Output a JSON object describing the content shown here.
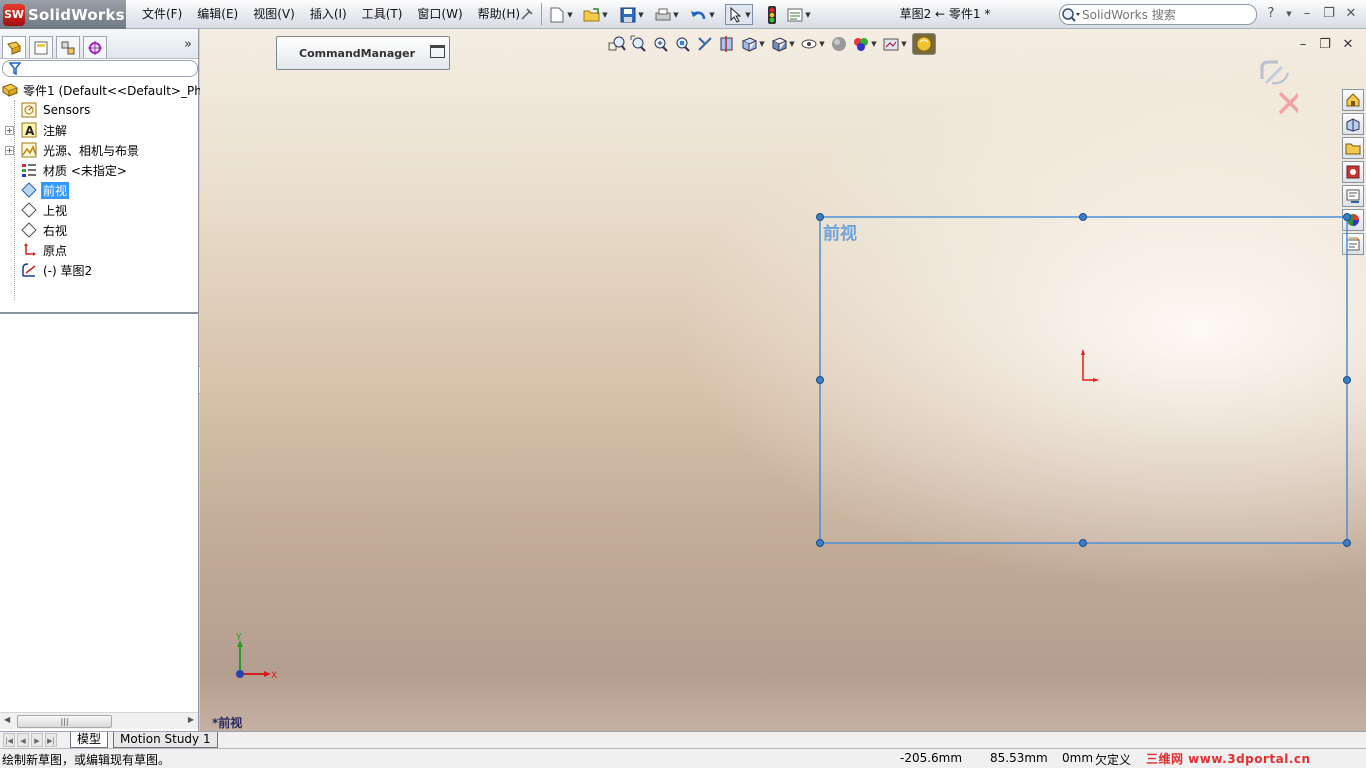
{
  "app": {
    "brand": "SolidWorks",
    "document_title": "草图2 ← 零件1 *",
    "menus": [
      "文件(F)",
      "编辑(E)",
      "视图(V)",
      "插入(I)",
      "工具(T)",
      "窗口(W)",
      "帮助(H)"
    ],
    "search_placeholder": "SolidWorks 搜索",
    "help_label": "?",
    "window_controls": [
      "minimize",
      "restore",
      "close"
    ]
  },
  "feature_manager": {
    "tabs": [
      "featuremanager-tab",
      "propertymanager-tab",
      "configurationmanager-tab",
      "dimxpert-tab"
    ],
    "more": "»",
    "filter_placeholder": "",
    "tree": [
      {
        "label": "零件1  (Default<<Default>_Pho",
        "icon": "part-icon",
        "level": 0,
        "expand": false
      },
      {
        "label": "Sensors",
        "icon": "sensor-icon",
        "level": 1,
        "expand": false
      },
      {
        "label": "注解",
        "icon": "annotation-icon",
        "level": 1,
        "expand": true
      },
      {
        "label": "光源、相机与布景",
        "icon": "lights-cameras-icon",
        "level": 1,
        "expand": true
      },
      {
        "label": "材质 <未指定>",
        "icon": "material-icon",
        "level": 1,
        "expand": false
      },
      {
        "label": "前视",
        "icon": "plane-icon",
        "level": 1,
        "expand": false,
        "selected": true
      },
      {
        "label": "上视",
        "icon": "plane-icon",
        "level": 1,
        "expand": false
      },
      {
        "label": "右视",
        "icon": "plane-icon",
        "level": 1,
        "expand": false
      },
      {
        "label": "原点",
        "icon": "origin-icon",
        "level": 1,
        "expand": false
      },
      {
        "label": "(-) 草图2",
        "icon": "sketch-icon",
        "level": 1,
        "expand": false
      }
    ]
  },
  "graphics": {
    "command_manager_label": "CommandManager",
    "plane_label": "前视",
    "view_name": "*前视",
    "triad": {
      "x": "X",
      "y": "Y"
    }
  },
  "bottom_tabs": [
    {
      "label": "模型",
      "active": true
    },
    {
      "label": "Motion Study 1",
      "active": false
    }
  ],
  "status": {
    "message": "绘制新草图，或编辑现有草图。",
    "x": "-205.6mm",
    "y": "85.53mm",
    "z": "0mm",
    "state": "欠定义",
    "watermark": "三维网 www.3dportal.cn"
  },
  "colors": {
    "selection": "#3399ff",
    "sketch_plane": "#4a8fd6",
    "origin": "#e02020"
  }
}
